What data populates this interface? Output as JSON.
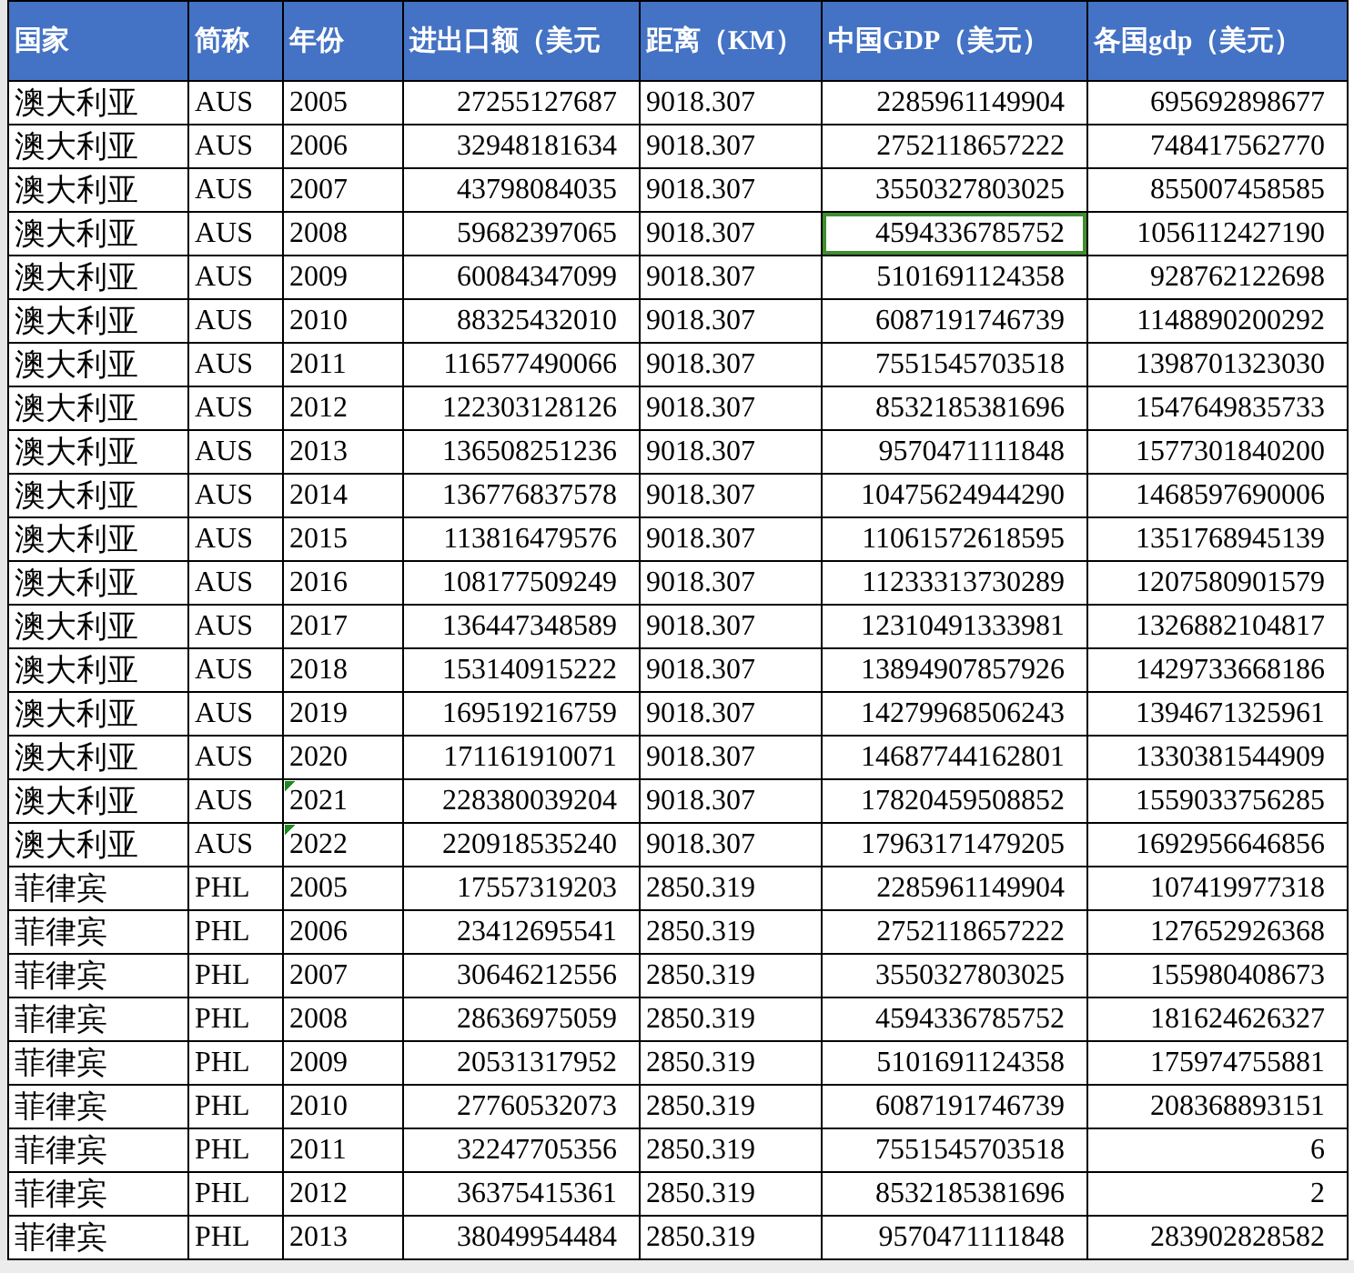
{
  "columns": [
    "国家",
    "简称",
    "年份",
    "进出口额（美元",
    "距离（KM）",
    "中国GDP（美元）",
    "各国gdp（美元）"
  ],
  "rows": [
    {
      "country": "澳大利亚",
      "code": "AUS",
      "year": {
        "value": "2005",
        "flagged": false
      },
      "trade": "27255127687",
      "distance": "9018.307",
      "china_gdp": {
        "value": "2285961149904",
        "selected": false
      },
      "gdp": "695692898677"
    },
    {
      "country": "澳大利亚",
      "code": "AUS",
      "year": {
        "value": "2006",
        "flagged": false
      },
      "trade": "32948181634",
      "distance": "9018.307",
      "china_gdp": {
        "value": "2752118657222",
        "selected": false
      },
      "gdp": "748417562770"
    },
    {
      "country": "澳大利亚",
      "code": "AUS",
      "year": {
        "value": "2007",
        "flagged": false
      },
      "trade": "43798084035",
      "distance": "9018.307",
      "china_gdp": {
        "value": "3550327803025",
        "selected": false
      },
      "gdp": "855007458585"
    },
    {
      "country": "澳大利亚",
      "code": "AUS",
      "year": {
        "value": "2008",
        "flagged": false
      },
      "trade": "59682397065",
      "distance": "9018.307",
      "china_gdp": {
        "value": "4594336785752",
        "selected": true
      },
      "gdp": "1056112427190"
    },
    {
      "country": "澳大利亚",
      "code": "AUS",
      "year": {
        "value": "2009",
        "flagged": false
      },
      "trade": "60084347099",
      "distance": "9018.307",
      "china_gdp": {
        "value": "5101691124358",
        "selected": false
      },
      "gdp": "928762122698"
    },
    {
      "country": "澳大利亚",
      "code": "AUS",
      "year": {
        "value": "2010",
        "flagged": false
      },
      "trade": "88325432010",
      "distance": "9018.307",
      "china_gdp": {
        "value": "6087191746739",
        "selected": false
      },
      "gdp": "1148890200292"
    },
    {
      "country": "澳大利亚",
      "code": "AUS",
      "year": {
        "value": "2011",
        "flagged": false
      },
      "trade": "116577490066",
      "distance": "9018.307",
      "china_gdp": {
        "value": "7551545703518",
        "selected": false
      },
      "gdp": "1398701323030"
    },
    {
      "country": "澳大利亚",
      "code": "AUS",
      "year": {
        "value": "2012",
        "flagged": false
      },
      "trade": "122303128126",
      "distance": "9018.307",
      "china_gdp": {
        "value": "8532185381696",
        "selected": false
      },
      "gdp": "1547649835733"
    },
    {
      "country": "澳大利亚",
      "code": "AUS",
      "year": {
        "value": "2013",
        "flagged": false
      },
      "trade": "136508251236",
      "distance": "9018.307",
      "china_gdp": {
        "value": "9570471111848",
        "selected": false
      },
      "gdp": "1577301840200"
    },
    {
      "country": "澳大利亚",
      "code": "AUS",
      "year": {
        "value": "2014",
        "flagged": false
      },
      "trade": "136776837578",
      "distance": "9018.307",
      "china_gdp": {
        "value": "10475624944290",
        "selected": false
      },
      "gdp": "1468597690006"
    },
    {
      "country": "澳大利亚",
      "code": "AUS",
      "year": {
        "value": "2015",
        "flagged": false
      },
      "trade": "113816479576",
      "distance": "9018.307",
      "china_gdp": {
        "value": "11061572618595",
        "selected": false
      },
      "gdp": "1351768945139"
    },
    {
      "country": "澳大利亚",
      "code": "AUS",
      "year": {
        "value": "2016",
        "flagged": false
      },
      "trade": "108177509249",
      "distance": "9018.307",
      "china_gdp": {
        "value": "11233313730289",
        "selected": false
      },
      "gdp": "1207580901579"
    },
    {
      "country": "澳大利亚",
      "code": "AUS",
      "year": {
        "value": "2017",
        "flagged": false
      },
      "trade": "136447348589",
      "distance": "9018.307",
      "china_gdp": {
        "value": "12310491333981",
        "selected": false
      },
      "gdp": "1326882104817"
    },
    {
      "country": "澳大利亚",
      "code": "AUS",
      "year": {
        "value": "2018",
        "flagged": false
      },
      "trade": "153140915222",
      "distance": "9018.307",
      "china_gdp": {
        "value": "13894907857926",
        "selected": false
      },
      "gdp": "1429733668186"
    },
    {
      "country": "澳大利亚",
      "code": "AUS",
      "year": {
        "value": "2019",
        "flagged": false
      },
      "trade": "169519216759",
      "distance": "9018.307",
      "china_gdp": {
        "value": "14279968506243",
        "selected": false
      },
      "gdp": "1394671325961"
    },
    {
      "country": "澳大利亚",
      "code": "AUS",
      "year": {
        "value": "2020",
        "flagged": false
      },
      "trade": "171161910071",
      "distance": "9018.307",
      "china_gdp": {
        "value": "14687744162801",
        "selected": false
      },
      "gdp": "1330381544909"
    },
    {
      "country": "澳大利亚",
      "code": "AUS",
      "year": {
        "value": "2021",
        "flagged": true
      },
      "trade": "228380039204",
      "distance": "9018.307",
      "china_gdp": {
        "value": "17820459508852",
        "selected": false
      },
      "gdp": "1559033756285"
    },
    {
      "country": "澳大利亚",
      "code": "AUS",
      "year": {
        "value": "2022",
        "flagged": true
      },
      "trade": "220918535240",
      "distance": "9018.307",
      "china_gdp": {
        "value": "17963171479205",
        "selected": false
      },
      "gdp": "1692956646856"
    },
    {
      "country": "菲律宾",
      "code": "PHL",
      "year": {
        "value": "2005",
        "flagged": false
      },
      "trade": "17557319203",
      "distance": "2850.319",
      "china_gdp": {
        "value": "2285961149904",
        "selected": false
      },
      "gdp": "107419977318"
    },
    {
      "country": "菲律宾",
      "code": "PHL",
      "year": {
        "value": "2006",
        "flagged": false
      },
      "trade": "23412695541",
      "distance": "2850.319",
      "china_gdp": {
        "value": "2752118657222",
        "selected": false
      },
      "gdp": "127652926368"
    },
    {
      "country": "菲律宾",
      "code": "PHL",
      "year": {
        "value": "2007",
        "flagged": false
      },
      "trade": "30646212556",
      "distance": "2850.319",
      "china_gdp": {
        "value": "3550327803025",
        "selected": false
      },
      "gdp": "155980408673"
    },
    {
      "country": "菲律宾",
      "code": "PHL",
      "year": {
        "value": "2008",
        "flagged": false
      },
      "trade": "28636975059",
      "distance": "2850.319",
      "china_gdp": {
        "value": "4594336785752",
        "selected": false
      },
      "gdp": "181624626327"
    },
    {
      "country": "菲律宾",
      "code": "PHL",
      "year": {
        "value": "2009",
        "flagged": false
      },
      "trade": "20531317952",
      "distance": "2850.319",
      "china_gdp": {
        "value": "5101691124358",
        "selected": false
      },
      "gdp": "175974755881"
    },
    {
      "country": "菲律宾",
      "code": "PHL",
      "year": {
        "value": "2010",
        "flagged": false
      },
      "trade": "27760532073",
      "distance": "2850.319",
      "china_gdp": {
        "value": "6087191746739",
        "selected": false
      },
      "gdp": "208368893151"
    },
    {
      "country": "菲律宾",
      "code": "PHL",
      "year": {
        "value": "2011",
        "flagged": false
      },
      "trade": "32247705356",
      "distance": "2850.319",
      "china_gdp": {
        "value": "7551545703518",
        "selected": false
      },
      "gdp": "6"
    },
    {
      "country": "菲律宾",
      "code": "PHL",
      "year": {
        "value": "2012",
        "flagged": false
      },
      "trade": "36375415361",
      "distance": "2850.319",
      "china_gdp": {
        "value": "8532185381696",
        "selected": false
      },
      "gdp": "2"
    },
    {
      "country": "菲律宾",
      "code": "PHL",
      "year": {
        "value": "2013",
        "flagged": false
      },
      "trade": "38049954484",
      "distance": "2850.319",
      "china_gdp": {
        "value": "9570471111848",
        "selected": false
      },
      "gdp": "283902828582"
    }
  ]
}
